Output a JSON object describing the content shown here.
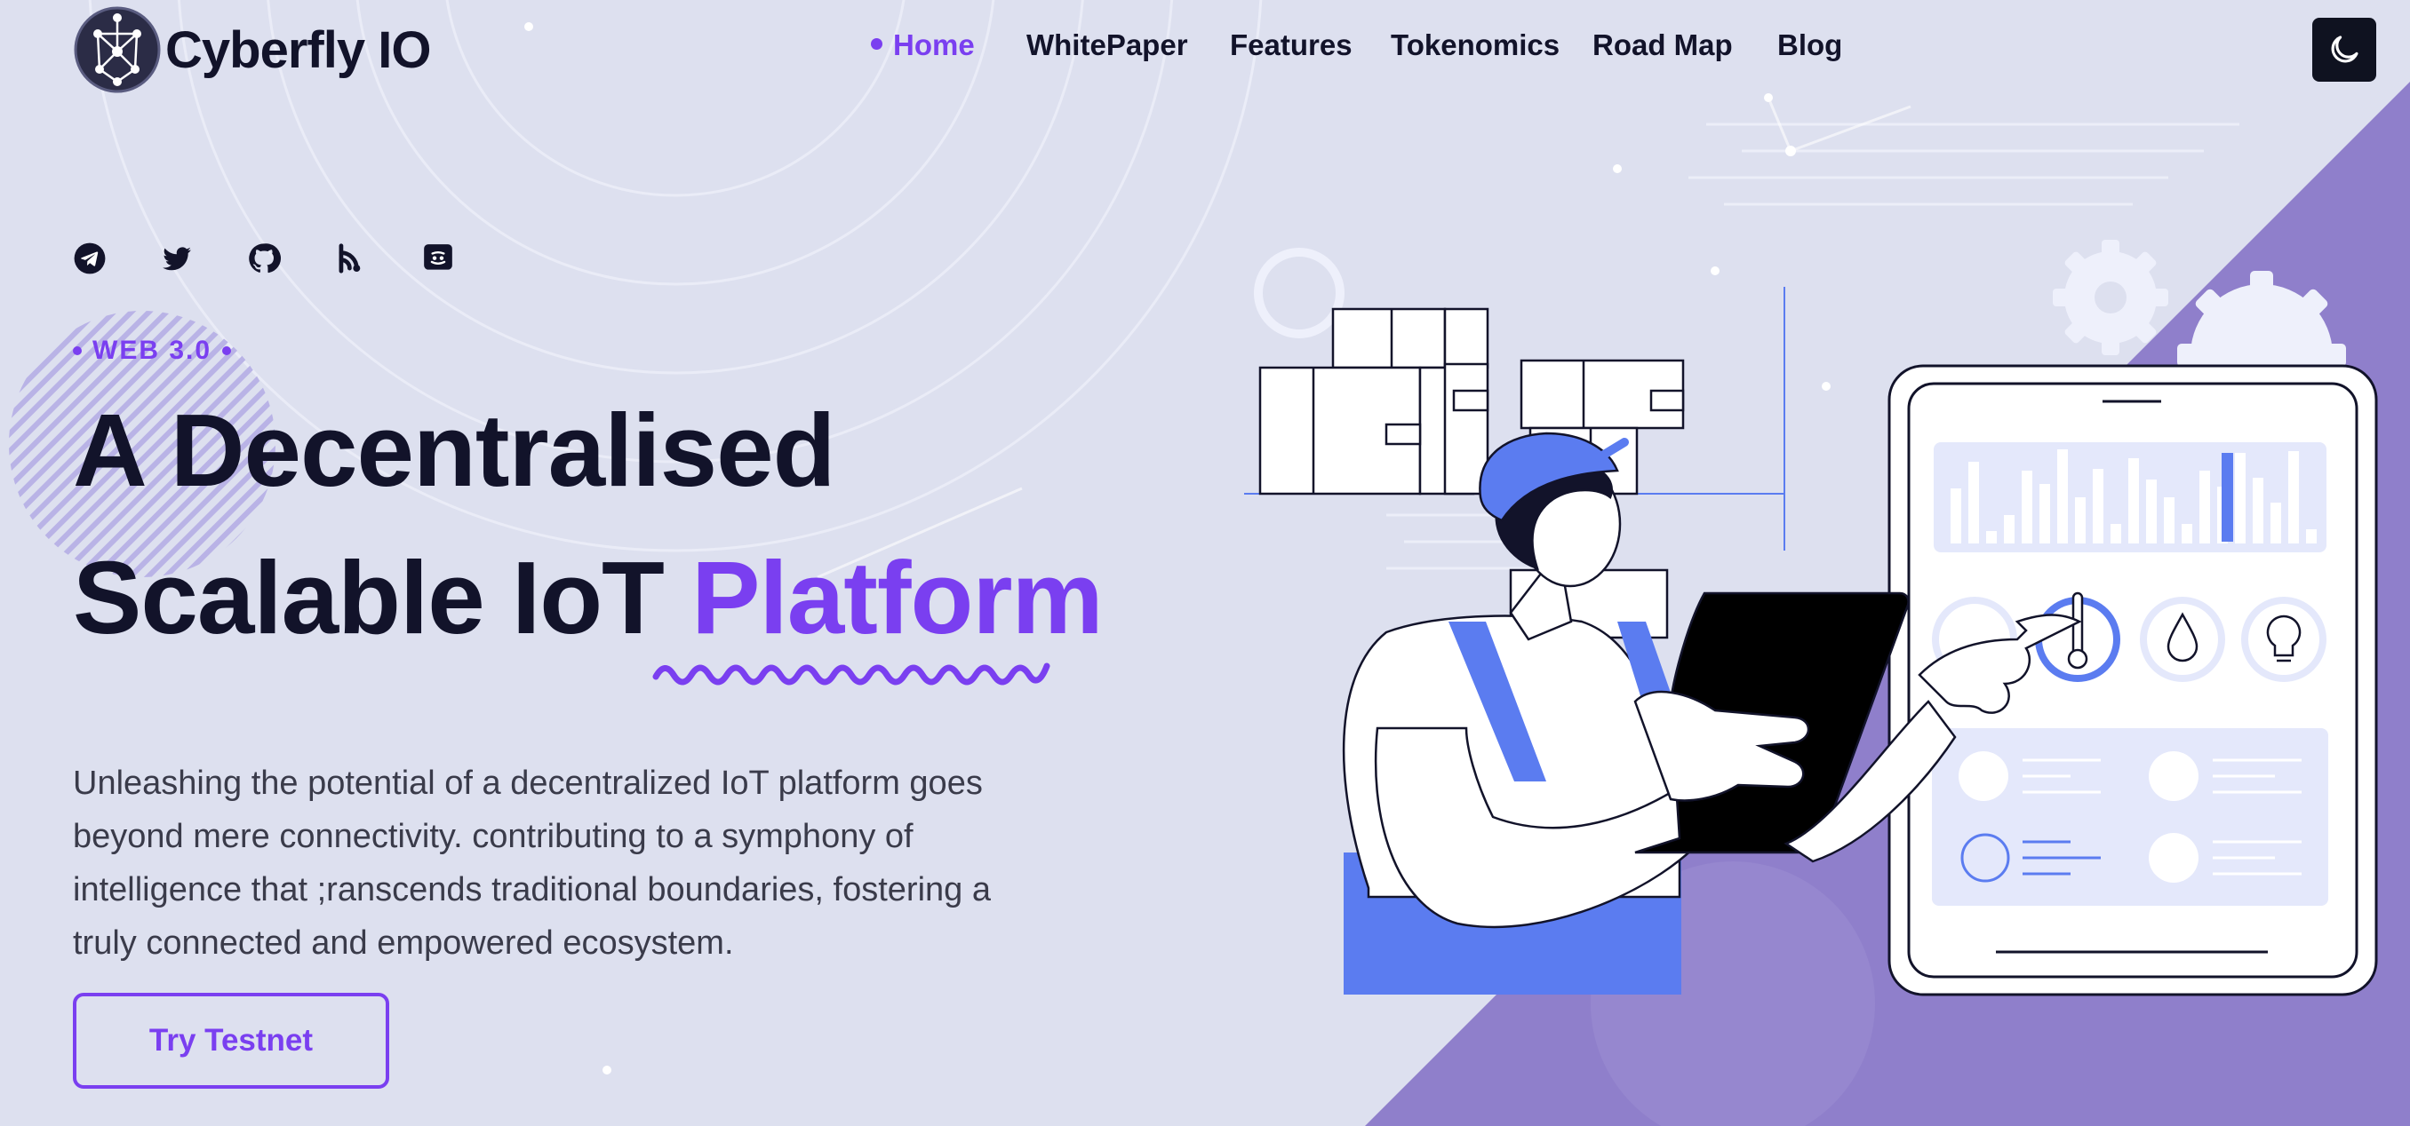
{
  "brand": {
    "name": "Cyberfly IO",
    "logo_icon": "network-node-logo-icon"
  },
  "nav": {
    "items": [
      {
        "label": "Home",
        "active": true
      },
      {
        "label": "WhitePaper",
        "active": false
      },
      {
        "label": "Features",
        "active": false
      },
      {
        "label": "Tokenomics",
        "active": false
      },
      {
        "label": "Road Map",
        "active": false
      },
      {
        "label": "Blog",
        "active": false
      }
    ],
    "theme_toggle_icon": "moon-icon"
  },
  "socials": [
    "telegram-icon",
    "twitter-icon",
    "github-icon",
    "blog-feed-icon",
    "discord-icon"
  ],
  "hero": {
    "badge": "WEB 3.0",
    "title_line1": "A Decentralised",
    "title_line2_plain": "Scalable IoT ",
    "title_line2_accent": "Platform",
    "description": "Unleashing the potential of a decentralized IoT platform goes beyond mere connectivity. contributing to a symphony of intelligence that ;ranscends traditional boundaries, fostering a truly connected and empowered ecosystem.",
    "cta_label": "Try Testnet"
  },
  "colors": {
    "accent": "#7a3ff0",
    "dark": "#12132a",
    "background": "#dde0ef",
    "illustration_blue": "#5b7cf0",
    "triangle_purple": "#8f7fcb"
  }
}
